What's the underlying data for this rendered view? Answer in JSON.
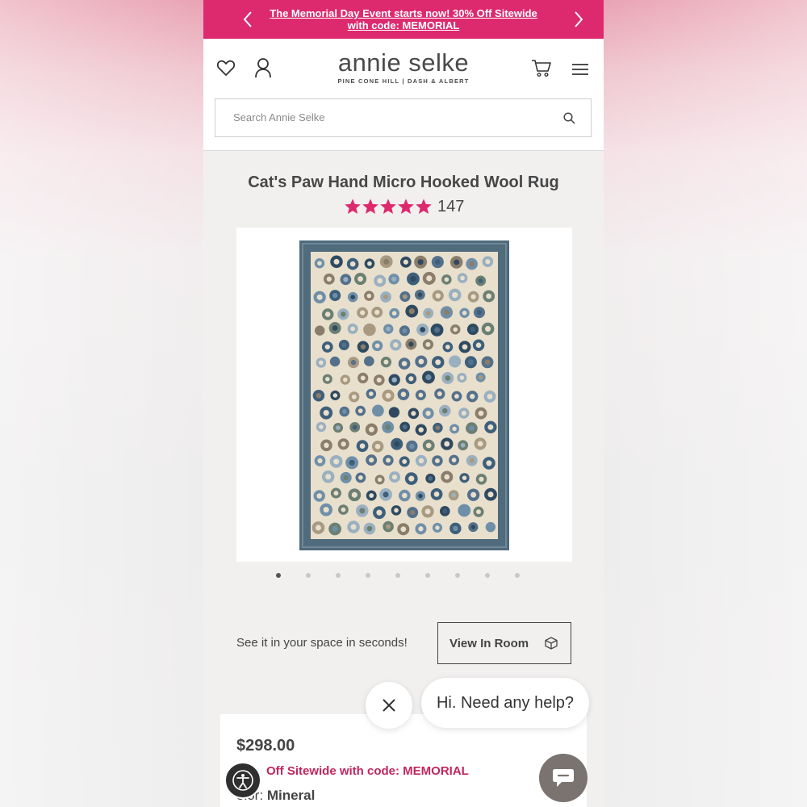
{
  "promo": {
    "text": "The Memorial Day Event starts now! 30% Off Sitewide with code: MEMORIAL",
    "prev_icon": "chevron-left-icon",
    "next_icon": "chevron-right-icon"
  },
  "header": {
    "logo": "annie selke",
    "sub_brands": "PINE CONE HILL  |  DASH & ALBERT",
    "icons": [
      "heart-icon",
      "user-icon",
      "cart-icon",
      "menu-icon"
    ]
  },
  "search": {
    "placeholder": "Search Annie Selke",
    "icon": "search-icon"
  },
  "product": {
    "title": "Cat's Paw Hand Micro Hooked Wool Rug",
    "rating": 5,
    "review_count": "147",
    "image_count": 9,
    "active_image": 1
  },
  "view_in_room": {
    "prompt": "See it in your space in seconds!",
    "button_label": "View In Room"
  },
  "chat": {
    "bubble_text": "Hi. Need any help?"
  },
  "pricing": {
    "price": "$298.00",
    "promo_visible": "Off Sitewide with code: MEMORIAL",
    "color_label": "olor:",
    "color_value": "Mineral"
  },
  "colors": {
    "brand_pink": "#dd2a6f",
    "star": "#dd2a6f",
    "rug_border": "#4f6b7c",
    "rug_field": "#e8dfcd"
  }
}
